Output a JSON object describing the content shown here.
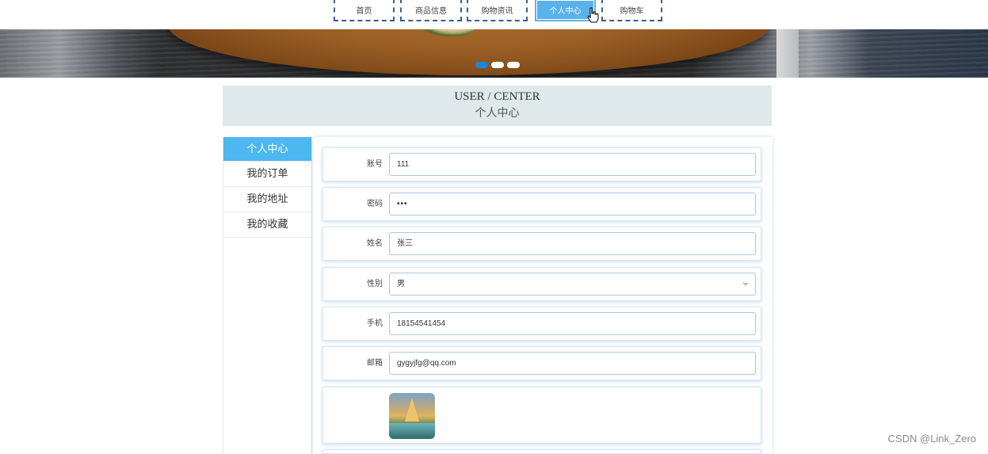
{
  "nav": {
    "items": [
      {
        "label": "首页"
      },
      {
        "label": "商品信息"
      },
      {
        "label": "购物资讯"
      },
      {
        "label": "个人中心"
      },
      {
        "label": "购物车"
      }
    ],
    "active_index": 3
  },
  "banner": {
    "dots": 3,
    "active_dot": 0
  },
  "page_title": {
    "en": "USER / CENTER",
    "zh": "个人中心"
  },
  "sidebar": {
    "items": [
      {
        "label": "个人中心"
      },
      {
        "label": "我的订单"
      },
      {
        "label": "我的地址"
      },
      {
        "label": "我的收藏"
      }
    ],
    "active_index": 0
  },
  "form": {
    "account": {
      "label": "账号",
      "value": "111"
    },
    "password": {
      "label": "密码",
      "value": "•••"
    },
    "name": {
      "label": "姓名",
      "value": "张三"
    },
    "gender": {
      "label": "性别",
      "value": "男"
    },
    "phone": {
      "label": "手机",
      "value": "18154541454"
    },
    "email": {
      "label": "邮箱",
      "value": "gygyjfg@qq.com"
    }
  },
  "watermark": "CSDN @Link_Zero",
  "colors": {
    "accent": "#4cb8ef",
    "nav_border": "#3a5f8f",
    "title_bg": "#dfe8ea",
    "dot_active": "#1a86d8"
  }
}
